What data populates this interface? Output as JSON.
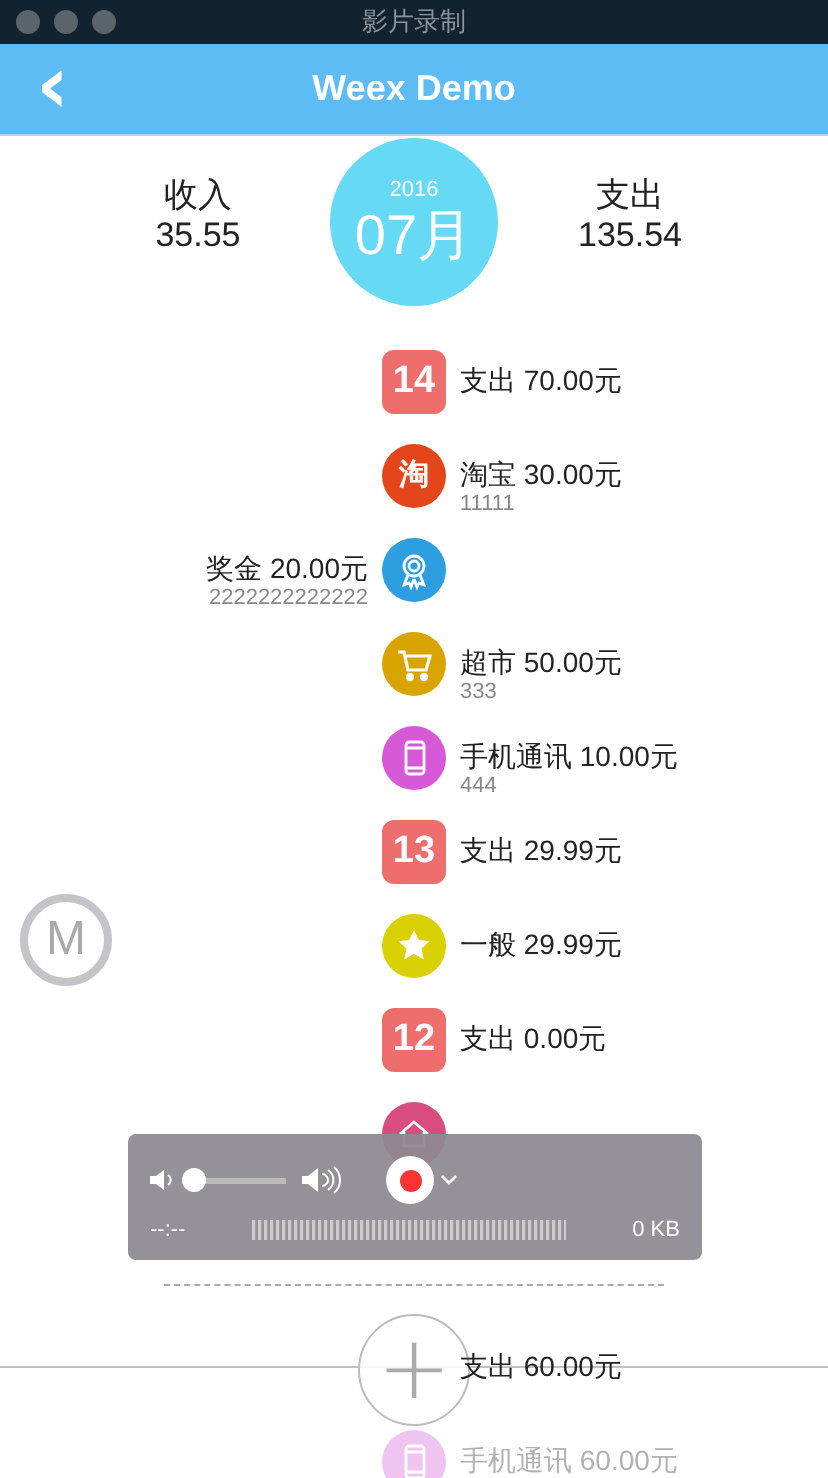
{
  "window": {
    "title": "影片录制"
  },
  "header": {
    "back": "‹",
    "title": "Weex Demo"
  },
  "summary": {
    "income_label": "收入",
    "income": "35.55",
    "year": "2016",
    "month": "07月",
    "expense_label": "支出",
    "expense": "135.54"
  },
  "floating_button": {
    "label": "M"
  },
  "timeline": [
    {
      "kind": "date",
      "income": false,
      "badge": "14",
      "color": "#ee6e6e",
      "label": "支出 70.00元",
      "faded": false
    },
    {
      "kind": "glyph",
      "income": false,
      "glyph": "淘",
      "color": "#e2461a",
      "label": "淘宝 30.00元",
      "note": "11111",
      "faded": false
    },
    {
      "kind": "award",
      "income": true,
      "color": "#2d9fe0",
      "label": "奖金 20.00元",
      "note": "2222222222222",
      "faded": false
    },
    {
      "kind": "cart",
      "income": false,
      "color": "#daa400",
      "label": "超市 50.00元",
      "note": "333",
      "faded": false
    },
    {
      "kind": "phone",
      "income": false,
      "color": "#d65ad8",
      "label": "手机通讯 10.00元",
      "note": "444",
      "faded": false
    },
    {
      "kind": "date",
      "income": false,
      "badge": "13",
      "color": "#ee6e6e",
      "label": "支出 29.99元",
      "faded": false
    },
    {
      "kind": "star",
      "income": false,
      "color": "#d9d000",
      "label": "一般 29.99元",
      "faded": false
    },
    {
      "kind": "date",
      "income": false,
      "badge": "12",
      "color": "#ee6e6e",
      "label": "支出 0.00元",
      "faded": false
    },
    {
      "kind": "house",
      "color": "#d84c7e",
      "faded": false
    },
    {
      "kind": "divider"
    },
    {
      "kind": "date",
      "income": false,
      "label": "支出 60.00元",
      "faded": false
    },
    {
      "kind": "phone",
      "income": false,
      "label": "手机通讯 60.00元",
      "faded": true
    }
  ],
  "add_button": {
    "label": "+"
  },
  "recorder": {
    "volume": {
      "level": 0
    },
    "recording": true,
    "time": "--:--",
    "size": "0 KB"
  }
}
